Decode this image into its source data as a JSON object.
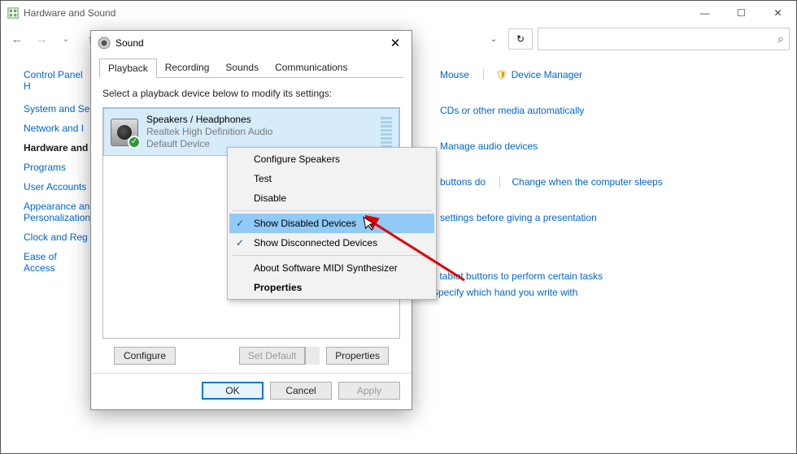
{
  "window": {
    "title": "Hardware and Sound"
  },
  "sidebar": {
    "home": "Control Panel H",
    "items": [
      "System and Se",
      "Network and I",
      "Hardware and",
      "Programs",
      "User Accounts",
      "Appearance an\nPersonalization",
      "Clock and Reg",
      "Ease of Access"
    ],
    "bold_index": 2
  },
  "main_links": {
    "row1": {
      "a": "Mouse",
      "b": "Device Manager"
    },
    "row2": {
      "a": " CDs or other media automatically"
    },
    "row3": {
      "a": "Manage audio devices"
    },
    "row4": {
      "a": "buttons do",
      "b": "Change when the computer sleeps"
    },
    "row5": {
      "a": "settings before giving a presentation"
    },
    "row6": {
      "a": "Set tablet buttons to perform certain tasks",
      "b": "Specify which hand you write with"
    }
  },
  "dialog": {
    "title": "Sound",
    "tabs": [
      "Playback",
      "Recording",
      "Sounds",
      "Communications"
    ],
    "active_tab": 0,
    "instruction": "Select a playback device below to modify its settings:",
    "device": {
      "name": "Speakers / Headphones",
      "driver": "Realtek High Definition Audio",
      "status": "Default Device"
    },
    "buttons": {
      "configure": "Configure",
      "set_default": "Set Default",
      "properties": "Properties",
      "ok": "OK",
      "cancel": "Cancel",
      "apply": "Apply"
    }
  },
  "context_menu": {
    "items": [
      {
        "label": "Configure Speakers"
      },
      {
        "label": "Test"
      },
      {
        "label": "Disable"
      },
      {
        "sep": true
      },
      {
        "label": "Show Disabled Devices",
        "checked": true,
        "highlight": true
      },
      {
        "label": "Show Disconnected Devices",
        "checked": true
      },
      {
        "sep": true
      },
      {
        "label": "About Software MIDI Synthesizer"
      },
      {
        "label": "Properties",
        "bold": true
      }
    ]
  }
}
